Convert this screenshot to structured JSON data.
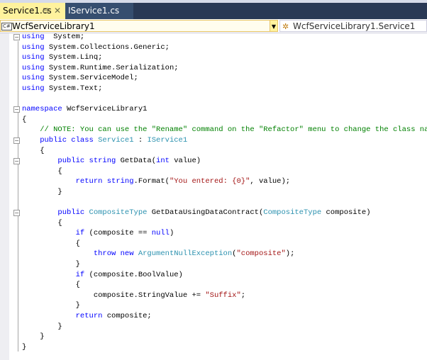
{
  "tabs": [
    {
      "label": "Service1.cs",
      "active": true
    },
    {
      "label": "IService1.cs",
      "active": false
    }
  ],
  "navbar": {
    "project": "WcfServiceLibrary1",
    "project_icon": "C#",
    "type": "WcfServiceLibrary1.Service1"
  },
  "colors": {
    "keyword": "#0000ff",
    "type": "#2b91af",
    "string": "#a31515",
    "comment": "#008000"
  },
  "code": [
    {
      "fold": true,
      "t": [
        [
          "kw",
          "using"
        ],
        [
          "",
          "  System;"
        ]
      ]
    },
    {
      "t": [
        [
          "kw",
          "using"
        ],
        [
          "",
          " System.Collections.Generic;"
        ]
      ]
    },
    {
      "t": [
        [
          "kw",
          "using"
        ],
        [
          "",
          " System.Linq;"
        ]
      ]
    },
    {
      "t": [
        [
          "kw",
          "using"
        ],
        [
          "",
          " System.Runtime.Serialization;"
        ]
      ]
    },
    {
      "t": [
        [
          "kw",
          "using"
        ],
        [
          "",
          " System.ServiceModel;"
        ]
      ]
    },
    {
      "t": [
        [
          "kw",
          "using"
        ],
        [
          "",
          " System.Text;"
        ]
      ]
    },
    {
      "t": []
    },
    {
      "fold": true,
      "t": [
        [
          "kw",
          "namespace"
        ],
        [
          "",
          " WcfServiceLibrary1"
        ]
      ]
    },
    {
      "t": [
        [
          "",
          "{"
        ]
      ]
    },
    {
      "t": [
        [
          "cm",
          "    // NOTE: You can use the \"Rename\" command on the \"Refactor\" menu to change the class name"
        ]
      ]
    },
    {
      "fold": true,
      "t": [
        [
          "kw",
          "    public class"
        ],
        [
          "ty",
          " Service1"
        ],
        [
          "",
          " : "
        ],
        [
          "ty",
          "IService1"
        ]
      ]
    },
    {
      "t": [
        [
          "",
          "    {"
        ]
      ]
    },
    {
      "fold": true,
      "t": [
        [
          "kw",
          "        public string"
        ],
        [
          "",
          " GetData("
        ],
        [
          "kw",
          "int"
        ],
        [
          "",
          " value)"
        ]
      ]
    },
    {
      "t": [
        [
          "",
          "        {"
        ]
      ]
    },
    {
      "t": [
        [
          "kw",
          "            return string"
        ],
        [
          "",
          ".Format("
        ],
        [
          "st",
          "\"You entered: {0}\""
        ],
        [
          "",
          ", value);"
        ]
      ]
    },
    {
      "t": [
        [
          "",
          "        }"
        ]
      ]
    },
    {
      "t": []
    },
    {
      "fold": true,
      "t": [
        [
          "kw",
          "        public"
        ],
        [
          "ty",
          " CompositeType"
        ],
        [
          "",
          " GetDataUsingDataContract("
        ],
        [
          "ty",
          "CompositeType"
        ],
        [
          "",
          " composite)"
        ]
      ]
    },
    {
      "t": [
        [
          "",
          "        {"
        ]
      ]
    },
    {
      "t": [
        [
          "kw",
          "            if"
        ],
        [
          "",
          " (composite == "
        ],
        [
          "kw",
          "null"
        ],
        [
          "",
          ")"
        ]
      ]
    },
    {
      "t": [
        [
          "",
          "            {"
        ]
      ]
    },
    {
      "t": [
        [
          "kw",
          "                throw new"
        ],
        [
          "ty",
          " ArgumentNullException"
        ],
        [
          "",
          "("
        ],
        [
          "st",
          "\"composite\""
        ],
        [
          "",
          ");"
        ]
      ]
    },
    {
      "t": [
        [
          "",
          "            }"
        ]
      ]
    },
    {
      "t": [
        [
          "kw",
          "            if"
        ],
        [
          "",
          " (composite.BoolValue)"
        ]
      ]
    },
    {
      "t": [
        [
          "",
          "            {"
        ]
      ]
    },
    {
      "t": [
        [
          "",
          "                composite.StringValue += "
        ],
        [
          "st",
          "\"Suffix\""
        ],
        [
          "",
          ";"
        ]
      ]
    },
    {
      "t": [
        [
          "",
          "            }"
        ]
      ]
    },
    {
      "t": [
        [
          "kw",
          "            return"
        ],
        [
          "",
          " composite;"
        ]
      ]
    },
    {
      "t": [
        [
          "",
          "        }"
        ]
      ]
    },
    {
      "t": [
        [
          "",
          "    }"
        ]
      ]
    },
    {
      "t": [
        [
          "",
          "}"
        ]
      ]
    }
  ]
}
